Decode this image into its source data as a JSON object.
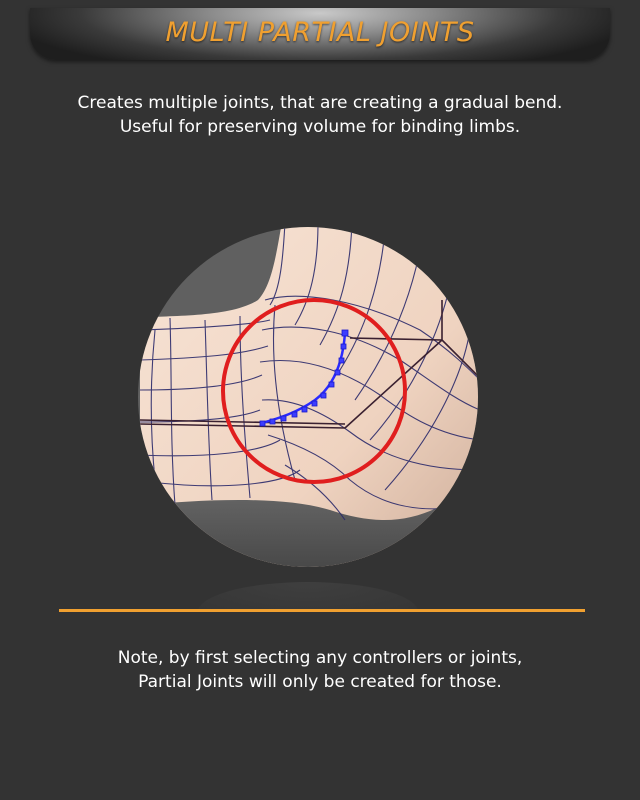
{
  "header": {
    "title": "MULTI PARTIAL JOINTS"
  },
  "description": {
    "line1": "Creates multiple joints, that are creating a gradual bend.",
    "line2": "Useful for preserving volume for binding limbs."
  },
  "illustration": {
    "highlight_color": "#e01e1e",
    "joint_chain_color": "#2a2aff",
    "mesh_skin_color": "#f2d9c8"
  },
  "note": {
    "line1": "Note, by first selecting any controllers or joints,",
    "line2": "Partial Joints will only be created for those."
  },
  "colors": {
    "background": "#333333",
    "accent": "#f0a030",
    "text": "#ffffff"
  }
}
